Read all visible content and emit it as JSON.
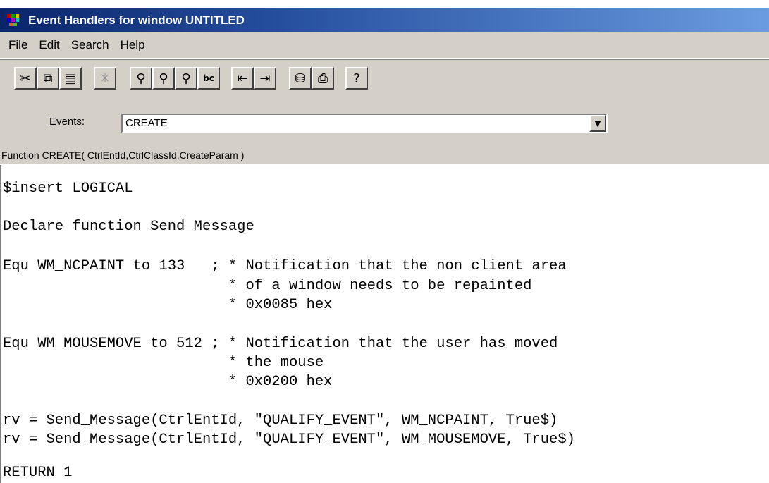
{
  "window": {
    "title": "Event Handlers for window UNTITLED"
  },
  "menu": [
    "File",
    "Edit",
    "Search",
    "Help"
  ],
  "toolbar": {
    "buttons": [
      {
        "name": "cut-icon",
        "glyph": "✂",
        "enabled": true
      },
      {
        "name": "copy-icon",
        "glyph": "⧉",
        "enabled": true
      },
      {
        "name": "paste-icon",
        "glyph": "📋",
        "enabled": true
      },
      {
        "name": "clear-icon",
        "glyph": "✳",
        "enabled": false
      },
      {
        "name": "find-icon",
        "glyph": "⚲",
        "enabled": true
      },
      {
        "name": "find-next-icon",
        "glyph": "⚲",
        "enabled": true
      },
      {
        "name": "replace-icon",
        "glyph": "⚲",
        "enabled": true
      },
      {
        "name": "compile-icon",
        "glyph": "bc",
        "enabled": true
      },
      {
        "name": "indent-icon",
        "glyph": "⇤",
        "enabled": true
      },
      {
        "name": "outdent-icon",
        "glyph": "⇥",
        "enabled": true
      },
      {
        "name": "save-icon",
        "glyph": "⎙",
        "enabled": true
      },
      {
        "name": "print-icon",
        "glyph": "⎙",
        "enabled": true
      },
      {
        "name": "help-icon",
        "glyph": "?",
        "enabled": true
      }
    ]
  },
  "events": {
    "label": "Events:",
    "selected": "CREATE"
  },
  "function_signature": "Function CREATE( CtrlEntId,CtrlClassId,CreateParam )",
  "code_lines": [
    "$insert LOGICAL",
    "Declare function Send_Message",
    "Equ WM_NCPAINT to 133   ; * Notification that the non client area",
    "                          * of a window needs to be repainted",
    "                          * 0x0085 hex",
    "Equ WM_MOUSEMOVE to 512 ; * Notification that the user has moved",
    "                          * the mouse",
    "                          * 0x0200 hex",
    "rv = Send_Message(CtrlEntId, \"QUALIFY_EVENT\", WM_NCPAINT, True$)",
    "rv = Send_Message(CtrlEntId, \"QUALIFY_EVENT\", WM_MOUSEMOVE, True$)",
    "RETURN 1"
  ]
}
